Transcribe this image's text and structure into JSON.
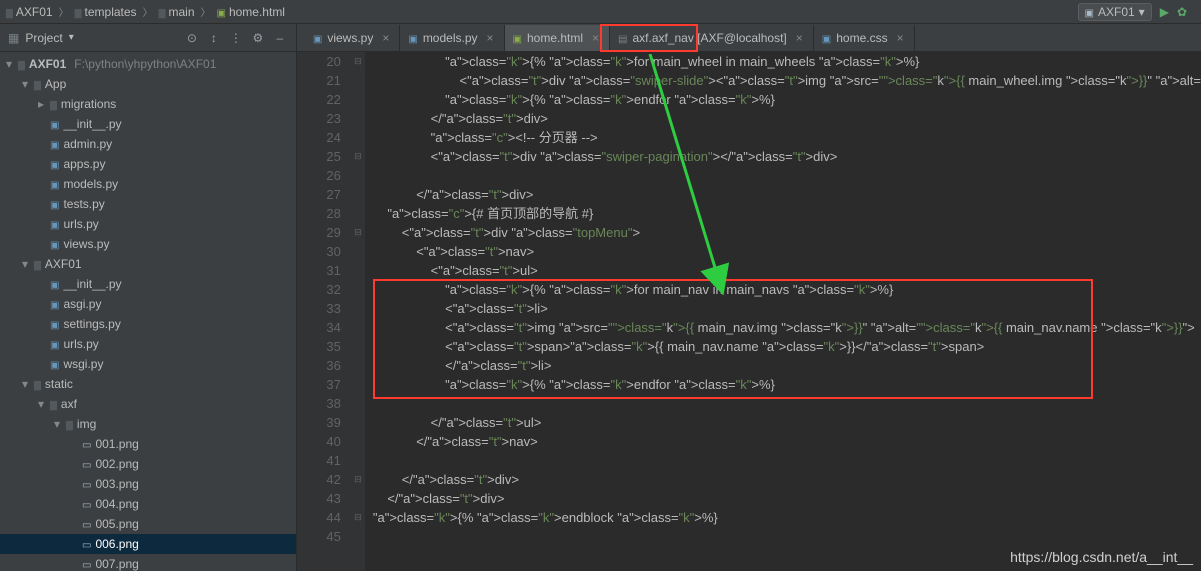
{
  "breadcrumb": [
    "AXF01",
    "templates",
    "main",
    "home.html"
  ],
  "run_config": "AXF01",
  "project_panel": {
    "label": "Project"
  },
  "root": {
    "name": "AXF01",
    "path": "F:\\python\\yhpython\\AXF01"
  },
  "tree": [
    {
      "label": "App",
      "depth": 1,
      "icon": "folder",
      "arrow": "open"
    },
    {
      "label": "migrations",
      "depth": 2,
      "icon": "folder",
      "arrow": "closed"
    },
    {
      "label": "__init__.py",
      "depth": 2,
      "icon": "py",
      "arrow": "none"
    },
    {
      "label": "admin.py",
      "depth": 2,
      "icon": "py",
      "arrow": "none"
    },
    {
      "label": "apps.py",
      "depth": 2,
      "icon": "py",
      "arrow": "none"
    },
    {
      "label": "models.py",
      "depth": 2,
      "icon": "py",
      "arrow": "none"
    },
    {
      "label": "tests.py",
      "depth": 2,
      "icon": "py",
      "arrow": "none"
    },
    {
      "label": "urls.py",
      "depth": 2,
      "icon": "py",
      "arrow": "none"
    },
    {
      "label": "views.py",
      "depth": 2,
      "icon": "py",
      "arrow": "none"
    },
    {
      "label": "AXF01",
      "depth": 1,
      "icon": "folder",
      "arrow": "open"
    },
    {
      "label": "__init__.py",
      "depth": 2,
      "icon": "py",
      "arrow": "none"
    },
    {
      "label": "asgi.py",
      "depth": 2,
      "icon": "py",
      "arrow": "none"
    },
    {
      "label": "settings.py",
      "depth": 2,
      "icon": "py",
      "arrow": "none"
    },
    {
      "label": "urls.py",
      "depth": 2,
      "icon": "py",
      "arrow": "none"
    },
    {
      "label": "wsgi.py",
      "depth": 2,
      "icon": "py",
      "arrow": "none"
    },
    {
      "label": "static",
      "depth": 1,
      "icon": "folder",
      "arrow": "open"
    },
    {
      "label": "axf",
      "depth": 2,
      "icon": "folder",
      "arrow": "open"
    },
    {
      "label": "img",
      "depth": 3,
      "icon": "folder",
      "arrow": "open"
    },
    {
      "label": "001.png",
      "depth": 4,
      "icon": "png",
      "arrow": "none"
    },
    {
      "label": "002.png",
      "depth": 4,
      "icon": "png",
      "arrow": "none"
    },
    {
      "label": "003.png",
      "depth": 4,
      "icon": "png",
      "arrow": "none"
    },
    {
      "label": "004.png",
      "depth": 4,
      "icon": "png",
      "arrow": "none"
    },
    {
      "label": "005.png",
      "depth": 4,
      "icon": "png",
      "arrow": "none"
    },
    {
      "label": "006.png",
      "depth": 4,
      "icon": "png",
      "arrow": "none",
      "selected": true
    },
    {
      "label": "007.png",
      "depth": 4,
      "icon": "png",
      "arrow": "none"
    }
  ],
  "tabs": [
    {
      "label": "views.py",
      "icon": "py"
    },
    {
      "label": "models.py",
      "icon": "py"
    },
    {
      "label": "home.html",
      "icon": "html",
      "active": true
    },
    {
      "label": "axf.axf_nav [AXF@localhost]",
      "icon": "db"
    },
    {
      "label": "home.css",
      "icon": "css"
    }
  ],
  "lines_start": 20,
  "code": [
    "                    {% for main_wheel in main_wheels %}",
    "                        <div class=\"swiper-slide\"><img src=\"{{ main_wheel.img }}\" alt=",
    "                    {% endfor %}",
    "                </div>",
    "                <!-- 分页器 -->",
    "                <div class=\"swiper-pagination\"></div>",
    "",
    "            </div>",
    "    {# 首页顶部的导航 #}",
    "        <div class=\"topMenu\">",
    "            <nav>",
    "                <ul>",
    "                    {% for main_nav in main_navs %}",
    "                    <li>",
    "                    <img src=\"{{ main_nav.img }}\" alt=\"{{ main_nav.name }}\">",
    "                    <span>{{ main_nav.name }}</span>",
    "                    </li>",
    "                    {% endfor %}",
    "",
    "                </ul>",
    "            </nav>",
    "",
    "        </div>",
    "    </div>",
    "{% endblock %}",
    ""
  ],
  "watermark": "https://blog.csdn.net/a__int__"
}
